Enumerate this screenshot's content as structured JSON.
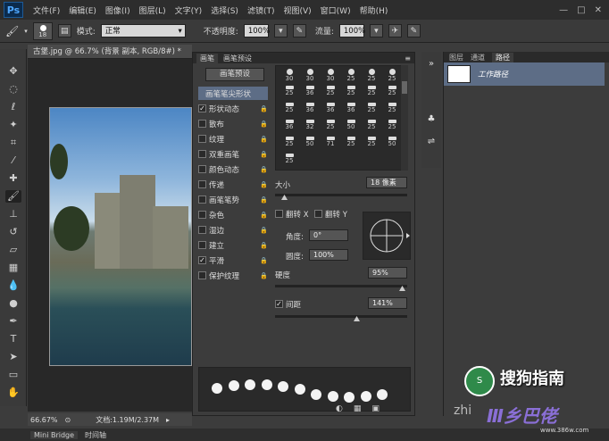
{
  "app": {
    "logo": "Ps"
  },
  "menu": [
    "文件(F)",
    "编辑(E)",
    "图像(I)",
    "图层(L)",
    "文字(Y)",
    "选择(S)",
    "滤镜(T)",
    "视图(V)",
    "窗口(W)",
    "帮助(H)"
  ],
  "window_controls": [
    "—",
    "□",
    "✕"
  ],
  "options": {
    "brush_size": "18",
    "mode_label": "模式:",
    "mode_value": "正常",
    "opacity_label": "不透明度:",
    "opacity_value": "100%",
    "flow_label": "流量:",
    "flow_value": "100%"
  },
  "document": {
    "tab_title": "古堡.jpg @ 66.7% (背景 副本, RGB/8#) *",
    "zoom": "66.67%",
    "doc_size": "文档:1.19M/2.37M"
  },
  "bottom_tabs": [
    "Mini Bridge",
    "时间轴"
  ],
  "brush_panel": {
    "tabs": [
      "画笔",
      "画笔预设"
    ],
    "preset_button": "画笔预设",
    "options": [
      {
        "label": "画笔笔尖形状",
        "checked": false,
        "selected": true,
        "lock": false
      },
      {
        "label": "形状动态",
        "checked": true,
        "selected": false,
        "lock": true
      },
      {
        "label": "散布",
        "checked": false,
        "selected": false,
        "lock": true
      },
      {
        "label": "纹理",
        "checked": false,
        "selected": false,
        "lock": true
      },
      {
        "label": "双重画笔",
        "checked": false,
        "selected": false,
        "lock": true
      },
      {
        "label": "颜色动态",
        "checked": false,
        "selected": false,
        "lock": true
      },
      {
        "label": "传递",
        "checked": false,
        "selected": false,
        "lock": true
      },
      {
        "label": "画笔笔势",
        "checked": false,
        "selected": false,
        "lock": true
      },
      {
        "label": "杂色",
        "checked": false,
        "selected": false,
        "lock": true
      },
      {
        "label": "湿边",
        "checked": false,
        "selected": false,
        "lock": true
      },
      {
        "label": "建立",
        "checked": false,
        "selected": false,
        "lock": true
      },
      {
        "label": "平滑",
        "checked": true,
        "selected": false,
        "lock": true
      },
      {
        "label": "保护纹理",
        "checked": false,
        "selected": false,
        "lock": true
      }
    ],
    "tip_sizes": [
      [
        "30",
        "30",
        "30",
        "25",
        "25",
        "25"
      ],
      [
        "25",
        "36",
        "25",
        "25",
        "25",
        "25"
      ],
      [
        "25",
        "36",
        "36",
        "36",
        "25",
        "25"
      ],
      [
        "36",
        "32",
        "25",
        "50",
        "25",
        "25"
      ],
      [
        "25",
        "50",
        "71",
        "25",
        "25",
        "50"
      ],
      [
        "25",
        "",
        "",
        "",
        "",
        ""
      ]
    ],
    "size_label": "大小",
    "size_value": "18 像素",
    "flip_x": "翻转 X",
    "flip_y": "翻转 Y",
    "angle_label": "角度:",
    "angle_value": "0°",
    "roundness_label": "圆度:",
    "roundness_value": "100%",
    "hardness_label": "硬度",
    "hardness_value": "95%",
    "spacing_label": "间距",
    "spacing_value": "141%",
    "spacing_checked": true
  },
  "paths_panel": {
    "tabs": [
      "图层",
      "通道",
      "路径"
    ],
    "path_name": "工作路径"
  },
  "watermark": {
    "text": "搜狗指南",
    "brand": "Ⅲ乡巴佬",
    "url": "www.386w.com",
    "prefix": "zhi"
  }
}
